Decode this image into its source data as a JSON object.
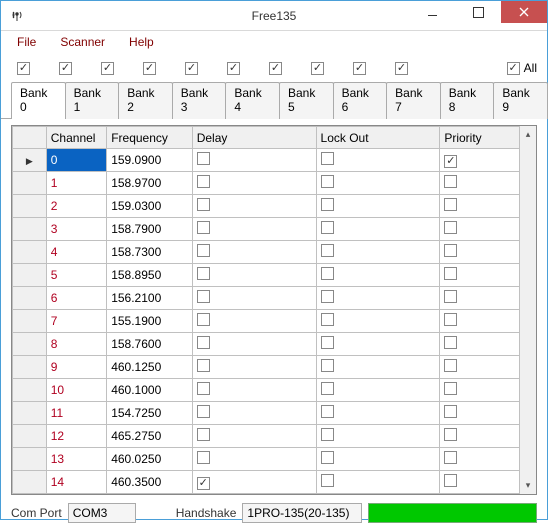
{
  "window": {
    "title": "Free135"
  },
  "menu": {
    "file": "File",
    "scanner": "Scanner",
    "help": "Help"
  },
  "bank_checks": {
    "all_label": "All",
    "states": [
      true,
      true,
      true,
      true,
      true,
      true,
      true,
      true,
      true,
      true
    ],
    "all_state": true
  },
  "tabs": [
    "Bank 0",
    "Bank 1",
    "Bank 2",
    "Bank 3",
    "Bank 4",
    "Bank 5",
    "Bank 6",
    "Bank 7",
    "Bank 8",
    "Bank 9"
  ],
  "active_tab": 0,
  "grid": {
    "columns": {
      "channel": "Channel",
      "frequency": "Frequency",
      "delay": "Delay",
      "lockout": "Lock Out",
      "priority": "Priority"
    },
    "selected_row": 0,
    "rows": [
      {
        "channel": "0",
        "frequency": "159.0900",
        "delay": false,
        "lockout": false,
        "priority": true
      },
      {
        "channel": "1",
        "frequency": "158.9700",
        "delay": false,
        "lockout": false,
        "priority": false
      },
      {
        "channel": "2",
        "frequency": "159.0300",
        "delay": false,
        "lockout": false,
        "priority": false
      },
      {
        "channel": "3",
        "frequency": "158.7900",
        "delay": false,
        "lockout": false,
        "priority": false
      },
      {
        "channel": "4",
        "frequency": "158.7300",
        "delay": false,
        "lockout": false,
        "priority": false
      },
      {
        "channel": "5",
        "frequency": "158.8950",
        "delay": false,
        "lockout": false,
        "priority": false
      },
      {
        "channel": "6",
        "frequency": "156.2100",
        "delay": false,
        "lockout": false,
        "priority": false
      },
      {
        "channel": "7",
        "frequency": "155.1900",
        "delay": false,
        "lockout": false,
        "priority": false
      },
      {
        "channel": "8",
        "frequency": "158.7600",
        "delay": false,
        "lockout": false,
        "priority": false
      },
      {
        "channel": "9",
        "frequency": "460.1250",
        "delay": false,
        "lockout": false,
        "priority": false
      },
      {
        "channel": "10",
        "frequency": "460.1000",
        "delay": false,
        "lockout": false,
        "priority": false
      },
      {
        "channel": "11",
        "frequency": "154.7250",
        "delay": false,
        "lockout": false,
        "priority": false
      },
      {
        "channel": "12",
        "frequency": "465.2750",
        "delay": false,
        "lockout": false,
        "priority": false
      },
      {
        "channel": "13",
        "frequency": "460.0250",
        "delay": false,
        "lockout": false,
        "priority": false
      },
      {
        "channel": "14",
        "frequency": "460.3500",
        "delay": true,
        "lockout": false,
        "priority": false
      }
    ]
  },
  "bottom": {
    "comport_label": "Com Port",
    "comport_value": "COM3",
    "handshake_label": "Handshake",
    "handshake_value": "1PRO-135(20-135)"
  }
}
